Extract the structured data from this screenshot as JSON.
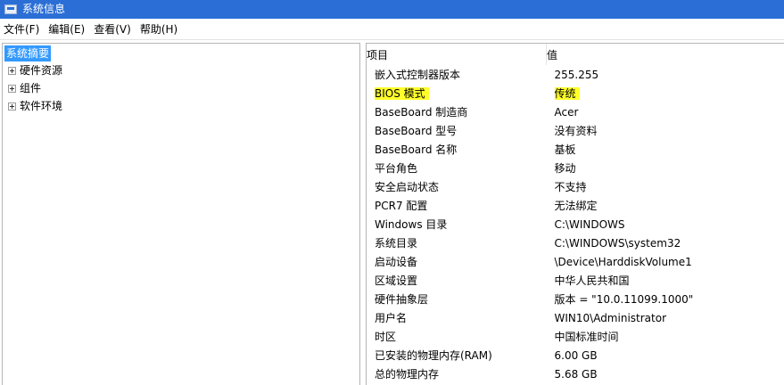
{
  "window": {
    "title": "系统信息",
    "icon": "system-info-icon"
  },
  "menu": [
    "文件(F)",
    "编辑(E)",
    "查看(V)",
    "帮助(H)"
  ],
  "tree": {
    "root": "系统摘要",
    "nodes": [
      "硬件资源",
      "组件",
      "软件环境"
    ]
  },
  "table": {
    "headers": {
      "item": "项目",
      "value": "值"
    },
    "rows": [
      {
        "item": "嵌入式控制器版本",
        "value": "255.255"
      },
      {
        "item": "BIOS 模式",
        "value": "传统"
      },
      {
        "item": "BaseBoard 制造商",
        "value": "Acer"
      },
      {
        "item": "BaseBoard 型号",
        "value": "没有资料"
      },
      {
        "item": "BaseBoard 名称",
        "value": "基板"
      },
      {
        "item": "平台角色",
        "value": "移动"
      },
      {
        "item": "安全启动状态",
        "value": "不支持"
      },
      {
        "item": "PCR7 配置",
        "value": "无法绑定"
      },
      {
        "item": "Windows 目录",
        "value": "C:\\WINDOWS"
      },
      {
        "item": "系统目录",
        "value": "C:\\WINDOWS\\system32"
      },
      {
        "item": "启动设备",
        "value": "\\Device\\HarddiskVolume1"
      },
      {
        "item": "区域设置",
        "value": "中华人民共和国"
      },
      {
        "item": "硬件抽象层",
        "value": "版本 = \"10.0.11099.1000\""
      },
      {
        "item": "用户名",
        "value": "WIN10\\Administrator"
      },
      {
        "item": "时区",
        "value": "中国标准时间"
      },
      {
        "item": "已安装的物理内存(RAM)",
        "value": "6.00 GB"
      },
      {
        "item": "总的物理内存",
        "value": "5.68 GB"
      }
    ]
  },
  "colors": {
    "titlebar": "#2b6fd6",
    "selection": "#3399ff",
    "highlight": "#ffff2a"
  }
}
